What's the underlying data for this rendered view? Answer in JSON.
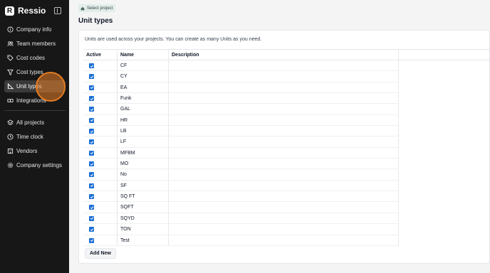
{
  "app": {
    "name": "Ressio"
  },
  "nav": {
    "group1": [
      {
        "label": "Company info",
        "icon": "info-icon"
      },
      {
        "label": "Team members",
        "icon": "users-icon"
      },
      {
        "label": "Cost codes",
        "icon": "tag-icon"
      },
      {
        "label": "Cost types",
        "icon": "filter-icon"
      },
      {
        "label": "Unit types",
        "icon": "ruler-icon",
        "active": true
      },
      {
        "label": "Integrations",
        "icon": "plug-icon"
      }
    ],
    "group2": [
      {
        "label": "All projects",
        "icon": "layers-icon"
      },
      {
        "label": "Time clock",
        "icon": "clock-icon"
      },
      {
        "label": "Vendors",
        "icon": "building-icon"
      },
      {
        "label": "Company settings",
        "icon": "gear-icon"
      }
    ]
  },
  "breadcrumb": {
    "label": "Select project",
    "icon": "home-icon"
  },
  "page": {
    "title": "Unit types",
    "description": "Units are used across your projects. You can create as many Units as you need."
  },
  "table": {
    "headers": {
      "active": "Active",
      "name": "Name",
      "description": "Description"
    },
    "rows": [
      {
        "active": true,
        "name": "CF"
      },
      {
        "active": true,
        "name": "CY"
      },
      {
        "active": true,
        "name": "EA"
      },
      {
        "active": true,
        "name": "Funk"
      },
      {
        "active": true,
        "name": "GAL"
      },
      {
        "active": true,
        "name": "HR"
      },
      {
        "active": true,
        "name": "LB"
      },
      {
        "active": true,
        "name": "LF"
      },
      {
        "active": true,
        "name": "MFBM"
      },
      {
        "active": true,
        "name": "MO"
      },
      {
        "active": true,
        "name": "No"
      },
      {
        "active": true,
        "name": "SF"
      },
      {
        "active": true,
        "name": "SQ FT"
      },
      {
        "active": true,
        "name": "SQFT"
      },
      {
        "active": true,
        "name": "SQYD"
      },
      {
        "active": true,
        "name": "TON"
      },
      {
        "active": true,
        "name": "Test"
      }
    ]
  },
  "actions": {
    "add_label": "Add New"
  },
  "colors": {
    "sidebar": "#171717",
    "accent": "#1d6fd6",
    "highlight": "#e07b21"
  }
}
